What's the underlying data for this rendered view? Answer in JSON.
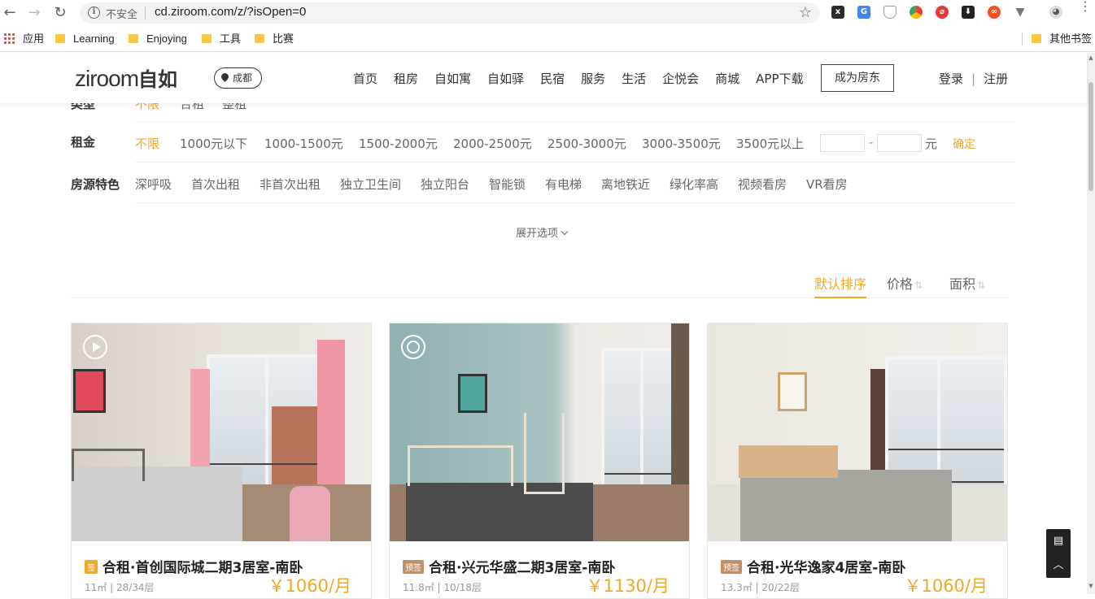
{
  "browser": {
    "insecure_label": "不安全",
    "url": "cd.ziroom.com/z/?isOpen=0",
    "bookmarks": [
      "应用",
      "Learning",
      "Enjoying",
      "工具",
      "比赛"
    ],
    "other_bookmarks": "其他书签"
  },
  "header": {
    "logo_text": "ziroom",
    "logo_cn": "自如",
    "city": "成都",
    "nav": [
      "首页",
      "租房",
      "自如寓",
      "自如驿",
      "民宿",
      "服务",
      "生活",
      "企悦会",
      "商城",
      "APP下载"
    ],
    "owner_button": "成为房东",
    "login": "登录",
    "divider": "|",
    "register": "注册"
  },
  "filters": {
    "type_row": {
      "label": "类型",
      "options": [
        "不限",
        "合租",
        "整租"
      ]
    },
    "rent_row": {
      "label": "租金",
      "options": [
        "不限",
        "1000元以下",
        "1000-1500元",
        "1500-2000元",
        "2000-2500元",
        "2500-3000元",
        "3000-3500元",
        "3500元以上"
      ],
      "range_dash": "-",
      "unit": "元",
      "confirm": "确定"
    },
    "feature_row": {
      "label": "房源特色",
      "options": [
        "深呼吸",
        "首次出租",
        "非首次出租",
        "独立卫生间",
        "独立阳台",
        "智能锁",
        "有电梯",
        "离地铁近",
        "绿化率高",
        "视频看房",
        "VR看房"
      ]
    },
    "expand": "展开选项"
  },
  "sort": {
    "items": [
      "默认排序",
      "价格",
      "面积"
    ],
    "arrows": "⇅"
  },
  "listings": [
    {
      "tag": "签",
      "title": "合租·首创国际城二期3居室-南卧",
      "meta": "11㎡ | 28/34层",
      "price": "￥1060/月"
    },
    {
      "tag": "预签",
      "title": "合租·兴元华盛二期3居室-南卧",
      "meta": "11.8㎡ | 10/18层",
      "price": "￥1130/月"
    },
    {
      "tag": "预签",
      "title": "合租·光华逸家4居室-南卧",
      "meta": "13.3㎡ | 20/22层",
      "price": "￥1060/月"
    }
  ],
  "colors": {
    "accent": "#f5a623",
    "tag_pre": "#c58f66"
  }
}
